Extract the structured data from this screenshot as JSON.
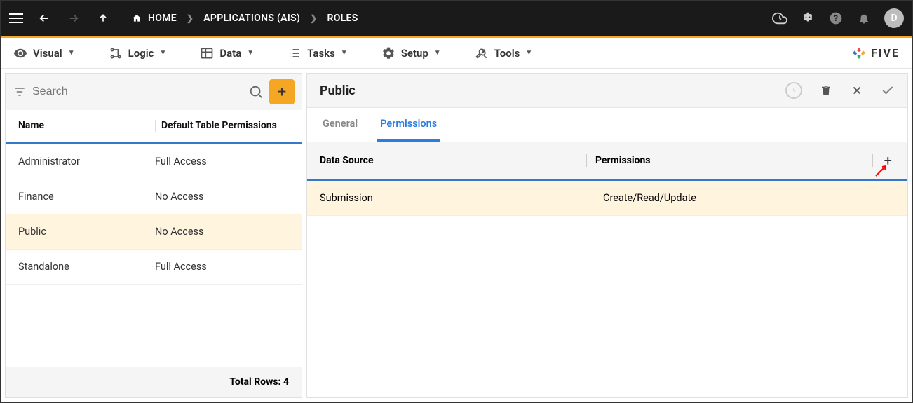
{
  "topbar": {
    "breadcrumbs": [
      "HOME",
      "APPLICATIONS (AIS)",
      "ROLES"
    ],
    "avatar_letter": "D"
  },
  "toolbar": {
    "items": [
      "Visual",
      "Logic",
      "Data",
      "Tasks",
      "Setup",
      "Tools"
    ],
    "brand": "FIVE"
  },
  "left": {
    "search_placeholder": "Search",
    "columns": [
      "Name",
      "Default Table Permissions"
    ],
    "rows": [
      {
        "name": "Administrator",
        "perm": "Full Access",
        "selected": false
      },
      {
        "name": "Finance",
        "perm": "No Access",
        "selected": false
      },
      {
        "name": "Public",
        "perm": "No Access",
        "selected": true
      },
      {
        "name": "Standalone",
        "perm": "Full Access",
        "selected": false
      }
    ],
    "footer": "Total Rows: 4"
  },
  "right": {
    "title": "Public",
    "tabs": [
      {
        "label": "General",
        "active": false
      },
      {
        "label": "Permissions",
        "active": true
      }
    ],
    "perm_columns": [
      "Data Source",
      "Permissions"
    ],
    "perm_rows": [
      {
        "source": "Submission",
        "perm": "Create/Read/Update"
      }
    ]
  }
}
